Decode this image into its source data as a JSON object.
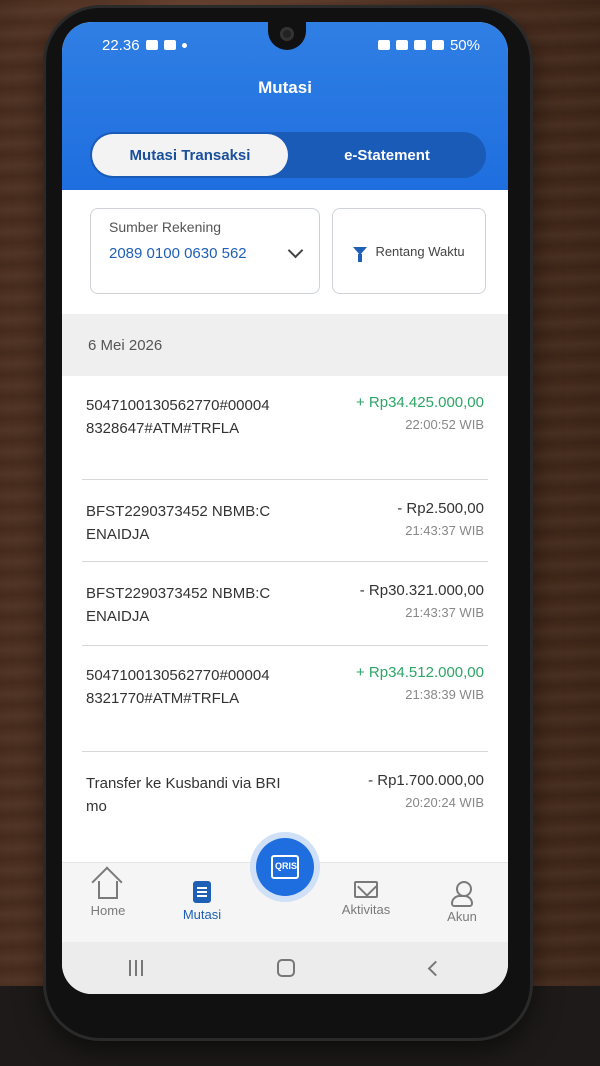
{
  "status_bar": {
    "time": "22.36",
    "battery": "50%"
  },
  "header": {
    "title": "Mutasi"
  },
  "tabs": [
    {
      "label": "Mutasi Transaksi",
      "active": true
    },
    {
      "label": "e-Statement",
      "active": false
    }
  ],
  "filters": {
    "source_label": "Sumber Rekening",
    "source_value": "2089 0100 0630 562",
    "range_label": "Rentang Waktu"
  },
  "date_group": "6 Mei 2026",
  "transactions": [
    {
      "desc": "5047100130562770#000048328647#ATM#TRFLA",
      "amount": "+ Rp34.425.000,00",
      "time": "22:00:52 WIB",
      "type": "credit"
    },
    {
      "desc": "BFST2290373452 NBMB:CENAIDJA",
      "amount": "- Rp2.500,00",
      "time": "21:43:37 WIB",
      "type": "debit"
    },
    {
      "desc": "BFST2290373452 NBMB:CENAIDJA",
      "amount": "- Rp30.321.000,00",
      "time": "21:43:37 WIB",
      "type": "debit"
    },
    {
      "desc": "5047100130562770#000048321770#ATM#TRFLA",
      "amount": "+ Rp34.512.000,00",
      "time": "21:38:39 WIB",
      "type": "credit"
    },
    {
      "desc": "Transfer ke Kusbandi via BRImo",
      "amount": "- Rp1.700.000,00",
      "time": "20:20:24 WIB",
      "type": "debit"
    }
  ],
  "bottom_nav": {
    "home": "Home",
    "mutasi": "Mutasi",
    "qris": "QRIS",
    "aktivitas": "Aktivitas",
    "akun": "Akun"
  },
  "colors": {
    "primary": "#1f6ee0",
    "credit": "#2ea566",
    "tab_bg": "#1a5bb8"
  }
}
